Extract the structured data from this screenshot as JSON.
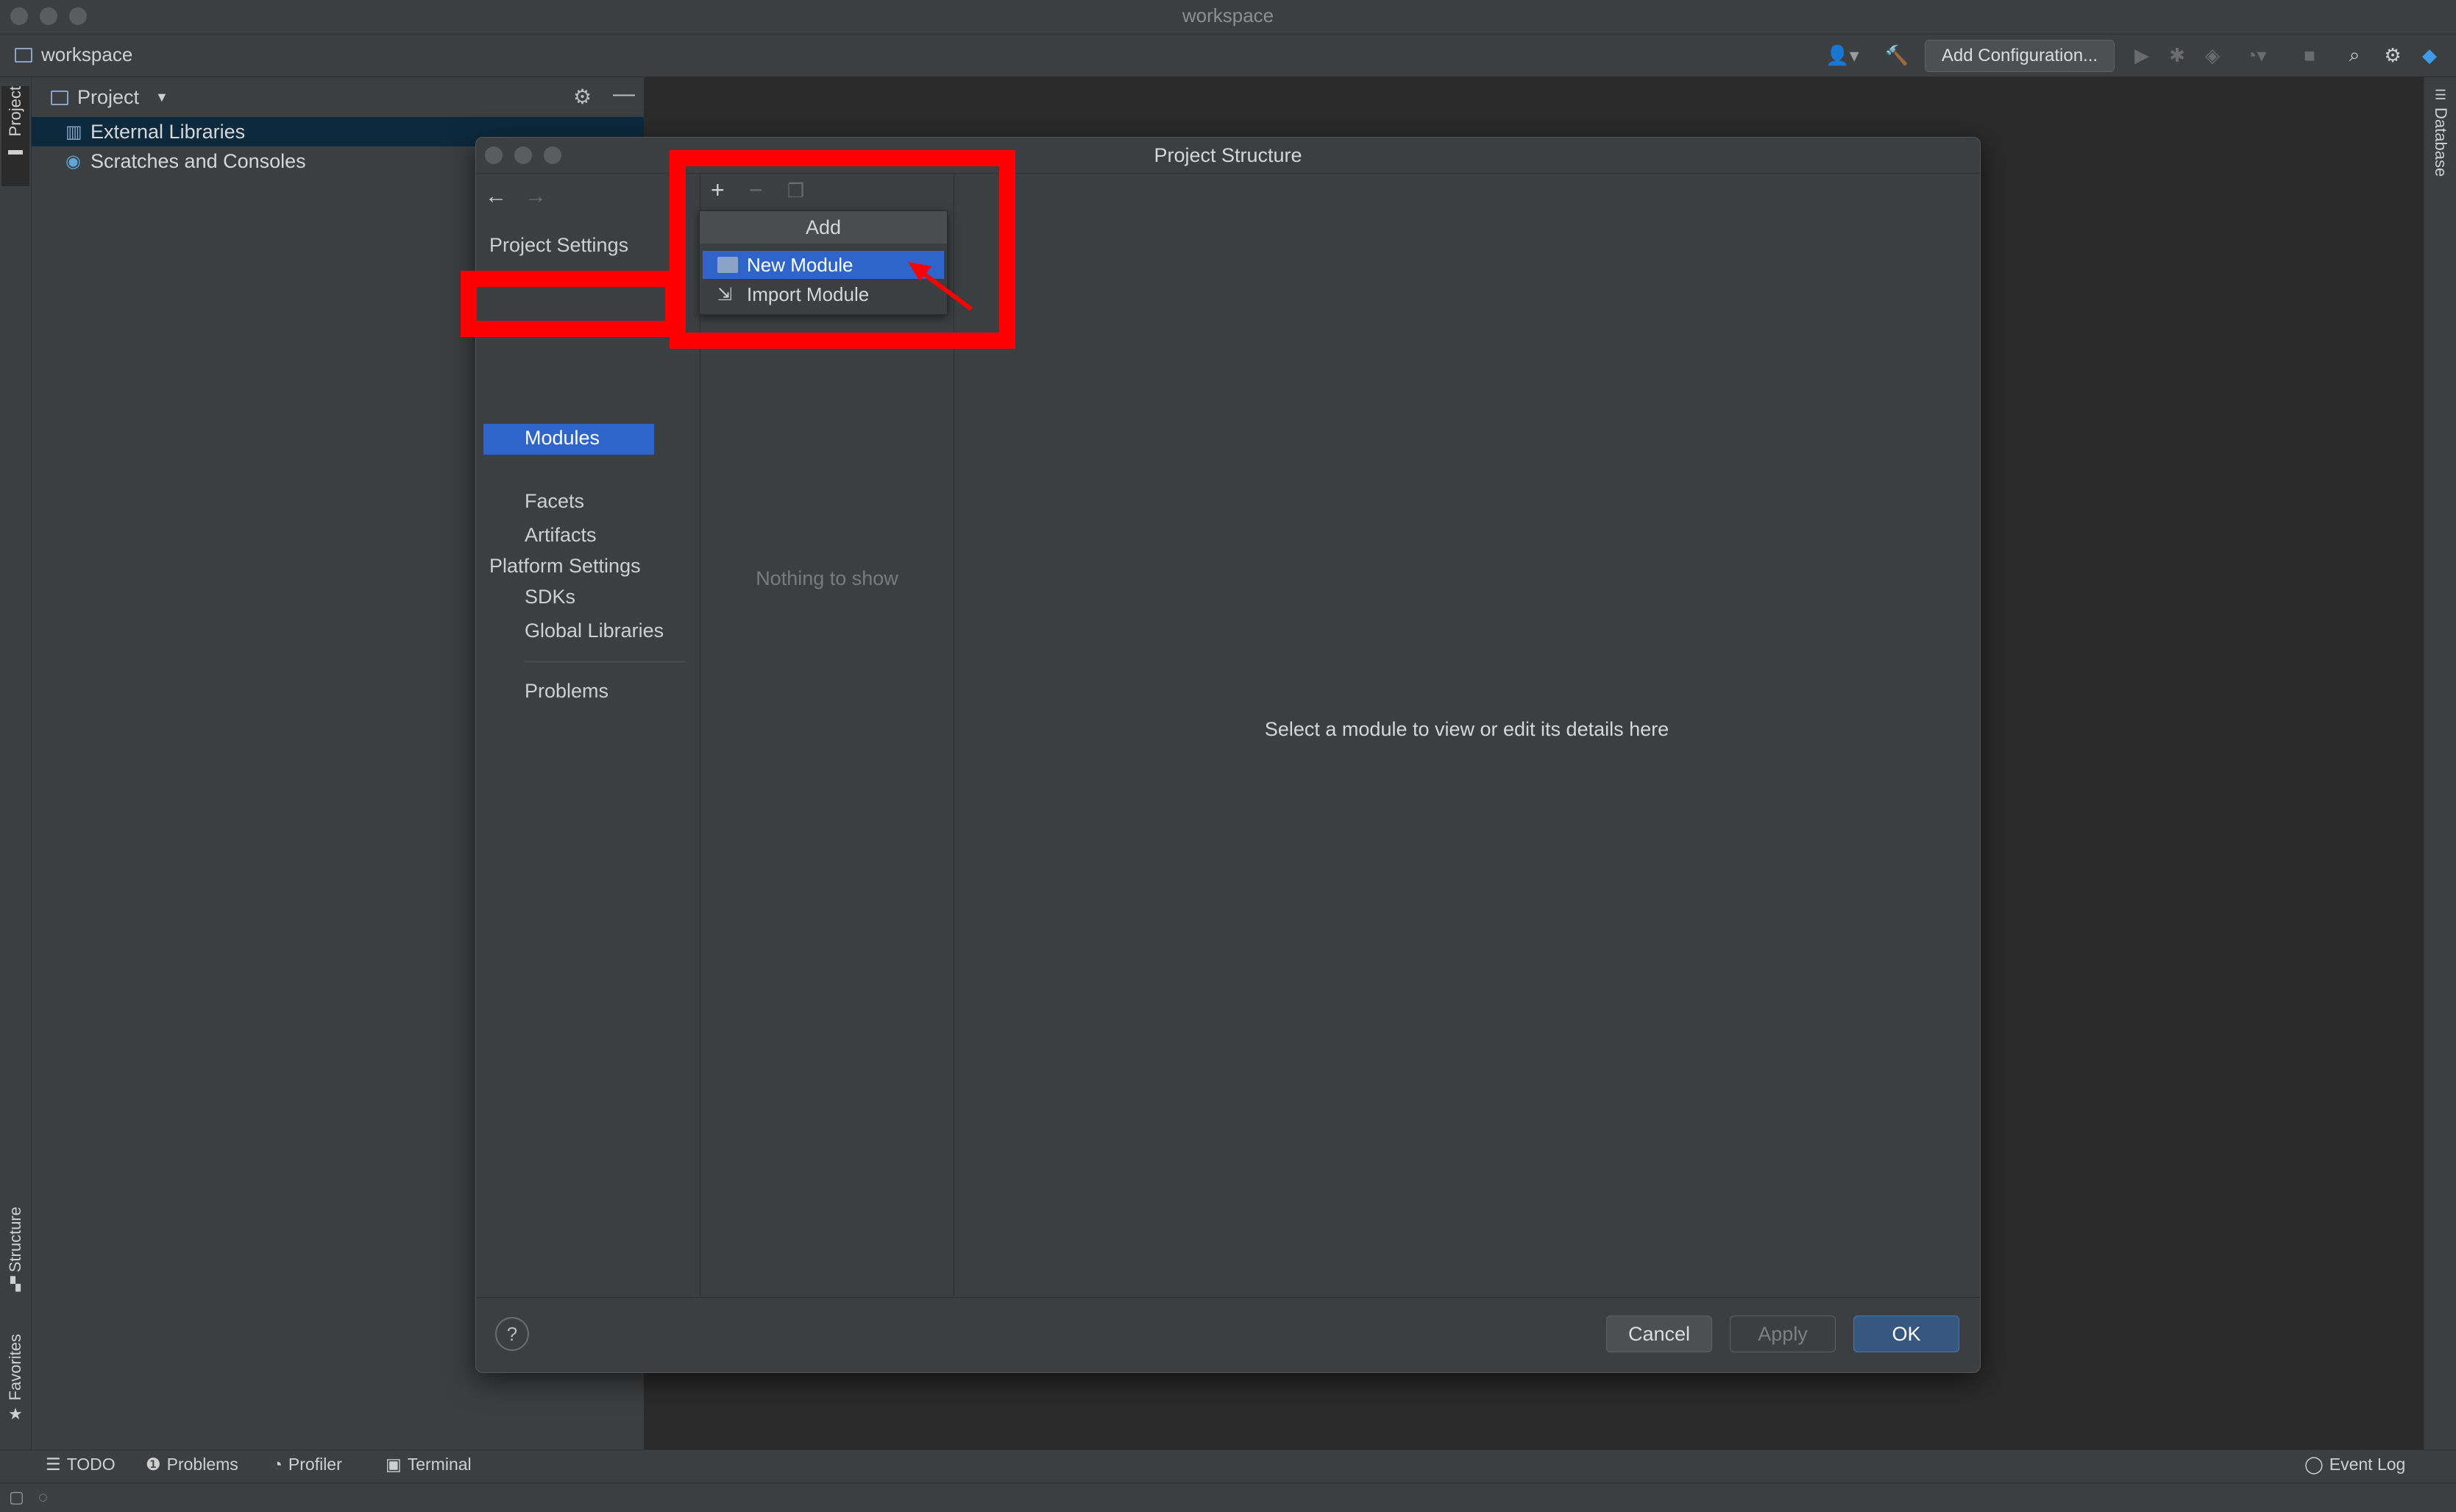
{
  "window": {
    "title": "workspace"
  },
  "navbar": {
    "project_name": "workspace",
    "add_configuration": "Add Configuration..."
  },
  "left_stripe": {
    "project_tab": "Project",
    "structure_tab": "Structure",
    "favorites_tab": "Favorites"
  },
  "right_stripe": {
    "database_tab": "Database"
  },
  "project_panel": {
    "header": "Project",
    "items": [
      {
        "label": "External Libraries"
      },
      {
        "label": "Scratches and Consoles"
      }
    ]
  },
  "dialog": {
    "title": "Project Structure",
    "nav": {
      "project_settings": "Project Settings",
      "modules": "Modules",
      "facets": "Facets",
      "artifacts": "Artifacts",
      "platform_settings": "Platform Settings",
      "sdks": "SDKs",
      "global_libraries": "Global Libraries",
      "problems": "Problems"
    },
    "empty_list": "Nothing to show",
    "detail_hint": "Select a module to view or edit its details here",
    "buttons": {
      "help": "?",
      "cancel": "Cancel",
      "apply": "Apply",
      "ok": "OK"
    },
    "add_popup": {
      "header": "Add",
      "items": [
        {
          "label": "New Module"
        },
        {
          "label": "Import Module"
        }
      ]
    }
  },
  "bottom_bar": {
    "todo": "TODO",
    "problems": "Problems",
    "profiler": "Profiler",
    "terminal": "Terminal",
    "event_log": "Event Log"
  },
  "colors": {
    "accent": "#2f65ca",
    "highlight": "#ff0000",
    "background": "#3c3f41",
    "editor": "#2b2b2b"
  }
}
